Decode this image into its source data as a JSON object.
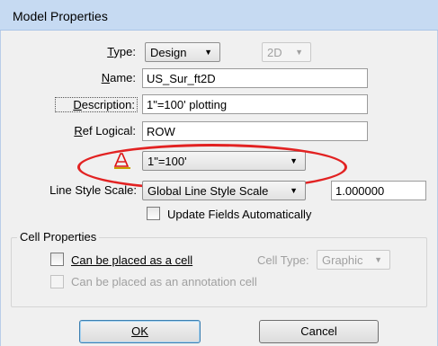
{
  "window": {
    "title": "Model Properties"
  },
  "type": {
    "label": "Type:",
    "value": "Design",
    "dim_value": "2D"
  },
  "name": {
    "label": "Name:",
    "value": "US_Sur_ft2D"
  },
  "description": {
    "label": "Description:",
    "value": "1\"=100' plotting"
  },
  "ref_logical": {
    "label": "Ref Logical:",
    "value": "ROW"
  },
  "annotation_scale": {
    "value": "1\"=100'"
  },
  "line_style_scale": {
    "label": "Line Style Scale:",
    "value": "Global Line Style Scale",
    "number": "1.000000"
  },
  "update_fields": {
    "label": "Update Fields Automatically"
  },
  "cell_properties": {
    "title": "Cell Properties",
    "can_be_cell": "Can be placed as a cell",
    "cell_type_label": "Cell Type:",
    "cell_type_value": "Graphic",
    "annotation_cell": "Can be placed as an annotation cell"
  },
  "buttons": {
    "ok": "OK",
    "cancel": "Cancel"
  },
  "colors": {
    "title_bar": "#c6daf2",
    "highlight_ellipse": "#e22222",
    "body": "#f0f0f0"
  }
}
